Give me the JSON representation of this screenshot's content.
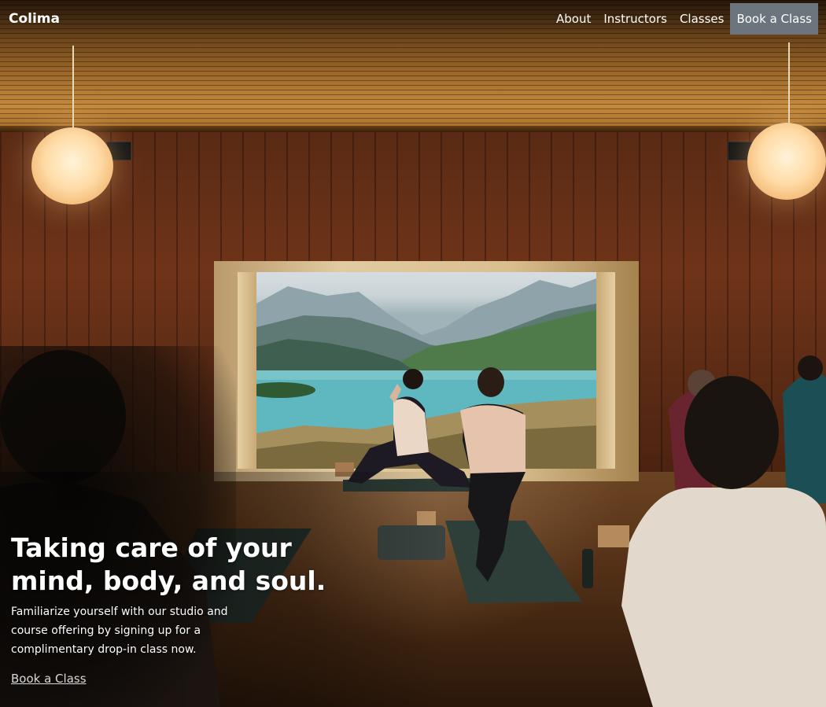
{
  "brand": "Colima",
  "nav": {
    "items": [
      {
        "label": "About"
      },
      {
        "label": "Instructors"
      },
      {
        "label": "Classes"
      }
    ],
    "cta_label": "Book a Class"
  },
  "hero": {
    "title": "Taking care of your mind, body, and soul.",
    "subtitle": "Familiarize yourself with our studio and course offering by signing up for a complimentary drop-in class now.",
    "link_label": "Book a Class"
  },
  "colors": {
    "nav_cta_bg": "#6c757d",
    "text": "#ffffff"
  }
}
